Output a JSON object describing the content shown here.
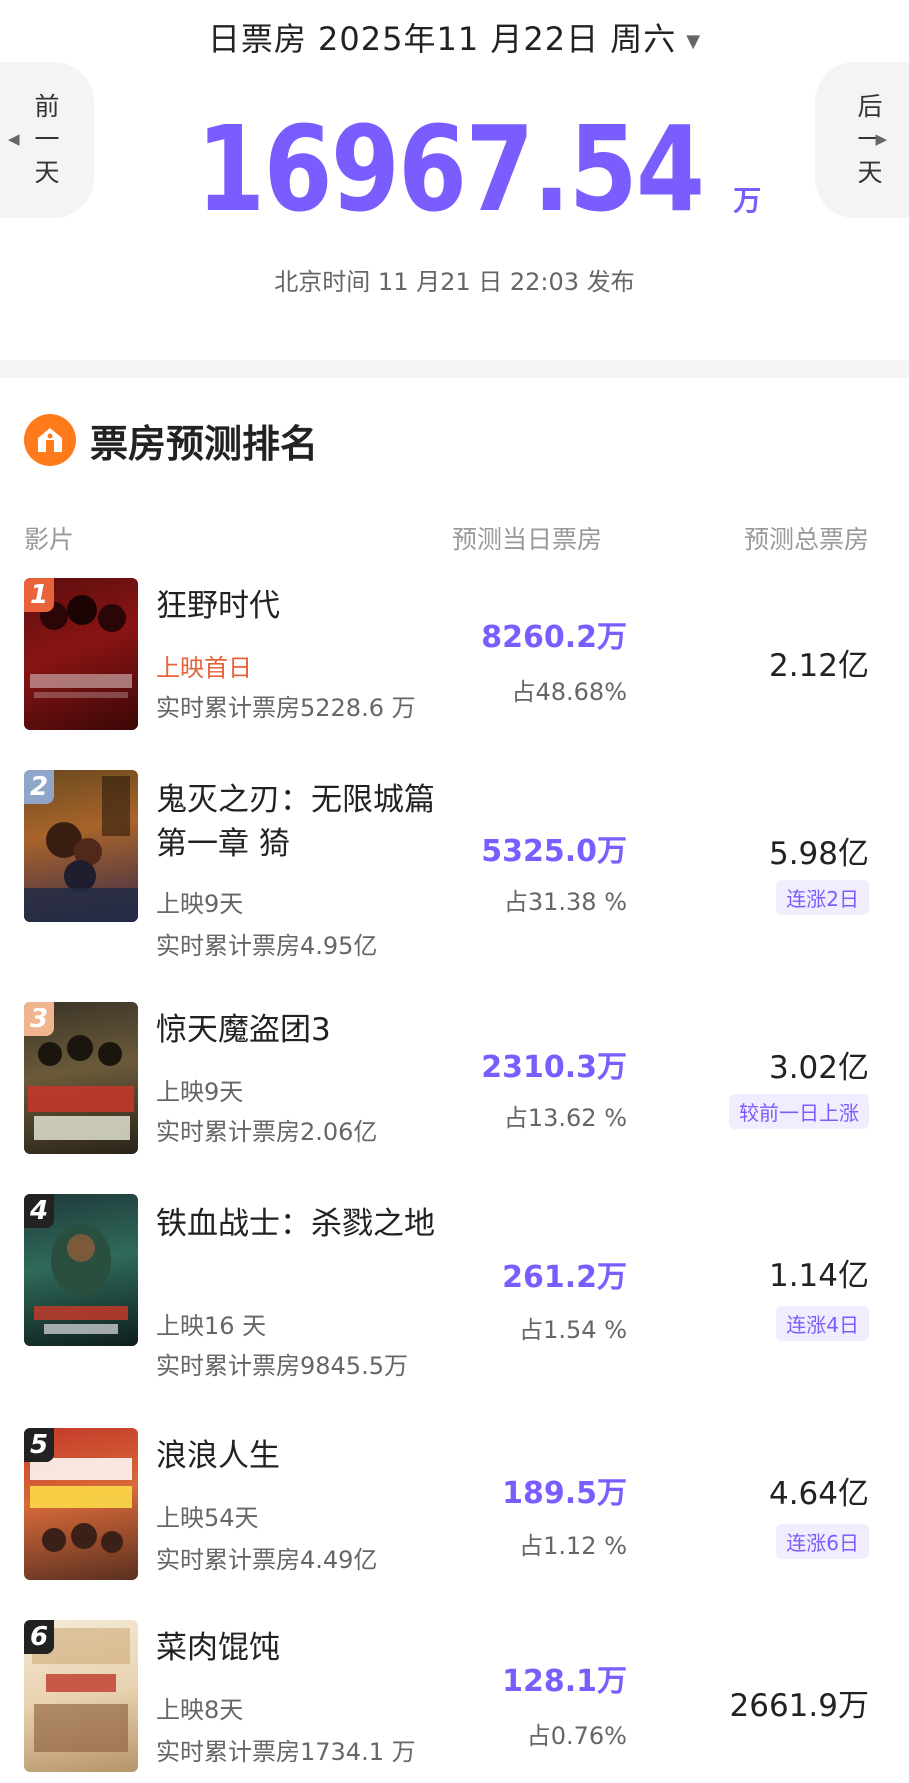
{
  "header": {
    "date_label": "日票房 2025年11 月22日 周六",
    "prev_day": "前一天",
    "next_day": "后一天",
    "total_value": "16967.54",
    "total_unit": "万",
    "publish_time": "北京时间 11 月21 日 22:03 发布"
  },
  "section": {
    "title": "票房预测排名",
    "col_film": "影片",
    "col_daily": "预测当日票房",
    "col_total": "预测总票房"
  },
  "colors": {
    "accent": "#7a5cff",
    "first_day": "#e8623a",
    "icon": "#ff7a1a"
  },
  "movies": [
    {
      "rank": "1",
      "name": "狂野时代",
      "release": "上映首日",
      "cumulative": "实时累计票房5228.6 万",
      "predicted_daily": "8260.2万",
      "share": "占48.68%",
      "predicted_total": "2.12亿",
      "tag": ""
    },
    {
      "rank": "2",
      "name": "鬼灭之刃：无限城篇 第一章 猗",
      "release": "上映9天",
      "cumulative": "实时累计票房4.95亿",
      "predicted_daily": "5325.0万",
      "share": "占31.38 %",
      "predicted_total": "5.98亿",
      "tag": "连涨2日"
    },
    {
      "rank": "3",
      "name": "惊天魔盗团3",
      "release": "上映9天",
      "cumulative": "实时累计票房2.06亿",
      "predicted_daily": "2310.3万",
      "share": "占13.62 %",
      "predicted_total": "3.02亿",
      "tag": "较前一日上涨"
    },
    {
      "rank": "4",
      "name": "铁血战士：杀戮之地",
      "release": "上映16 天",
      "cumulative": "实时累计票房9845.5万",
      "predicted_daily": "261.2万",
      "share": "占1.54 %",
      "predicted_total": "1.14亿",
      "tag": "连涨4日"
    },
    {
      "rank": "5",
      "name": "浪浪人生",
      "release": "上映54天",
      "cumulative": "实时累计票房4.49亿",
      "predicted_daily": "189.5万",
      "share": "占1.12 %",
      "predicted_total": "4.64亿",
      "tag": "连涨6日"
    },
    {
      "rank": "6",
      "name": "菜肉馄饨",
      "release": "上映8天",
      "cumulative": "实时累计票房1734.1 万",
      "predicted_daily": "128.1万",
      "share": "占0.76%",
      "predicted_total": "2661.9万",
      "tag": ""
    }
  ]
}
